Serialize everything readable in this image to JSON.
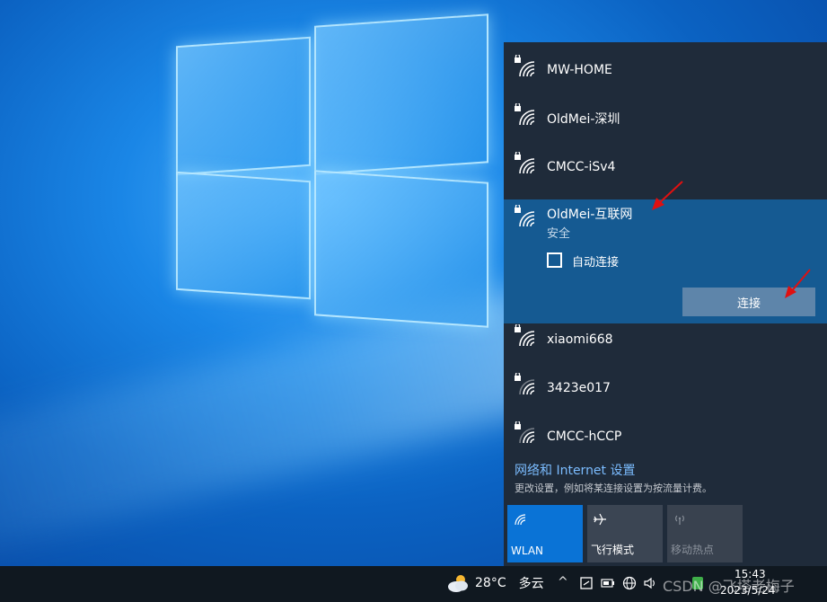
{
  "networks": [
    {
      "name": "MW-HOME"
    },
    {
      "name": "OldMei-深圳"
    },
    {
      "name": "CMCC-iSv4"
    }
  ],
  "selected_network": {
    "name": "OldMei-互联网",
    "status": "安全",
    "auto_connect_label": "自动连接",
    "connect_label": "连接"
  },
  "networks_more": [
    {
      "name": "xiaomi668"
    },
    {
      "name": "3423e017"
    },
    {
      "name": "CMCC-hCCP"
    }
  ],
  "settings": {
    "link": "网络和 Internet 设置",
    "description": "更改设置，例如将某连接设置为按流量计费。"
  },
  "tiles": {
    "wlan": "WLAN",
    "airplane": "飞行模式",
    "hotspot": "移动热点"
  },
  "taskbar": {
    "temperature": "28°C",
    "weather": "多云",
    "time": "15:43",
    "date": "2023/5/24",
    "watermark": "CSDN @飞塔老梅子"
  },
  "colors": {
    "flyout_bg": "#1f2b3a",
    "selected_bg": "#155a92",
    "accent": "#0a73d6",
    "link": "#7bbcff"
  }
}
